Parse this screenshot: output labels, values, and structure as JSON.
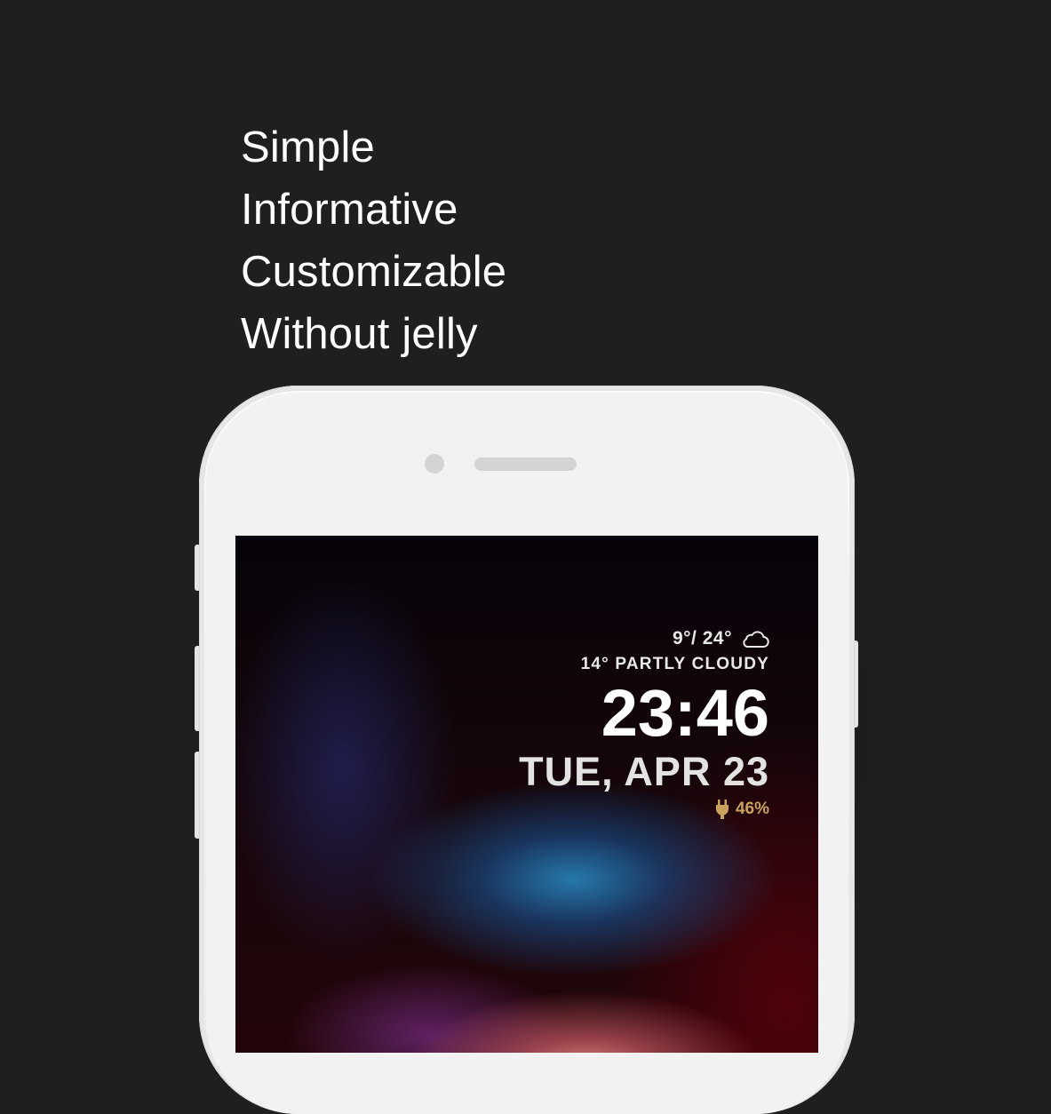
{
  "taglines": [
    "Simple",
    "Informative",
    "Customizable",
    "Without jelly"
  ],
  "lockscreen": {
    "temp_range": "9°/ 24°",
    "weather_icon": "cloud-icon",
    "condition": "14° PARTLY CLOUDY",
    "time": "23:46",
    "date": "TUE, APR 23",
    "charging_icon": "plug-icon",
    "battery": "46%"
  },
  "colors": {
    "background": "#1f1f1f",
    "phone_body": "#f2f2f2",
    "text": "#ffffff",
    "battery_accent": "#c9a35e"
  }
}
